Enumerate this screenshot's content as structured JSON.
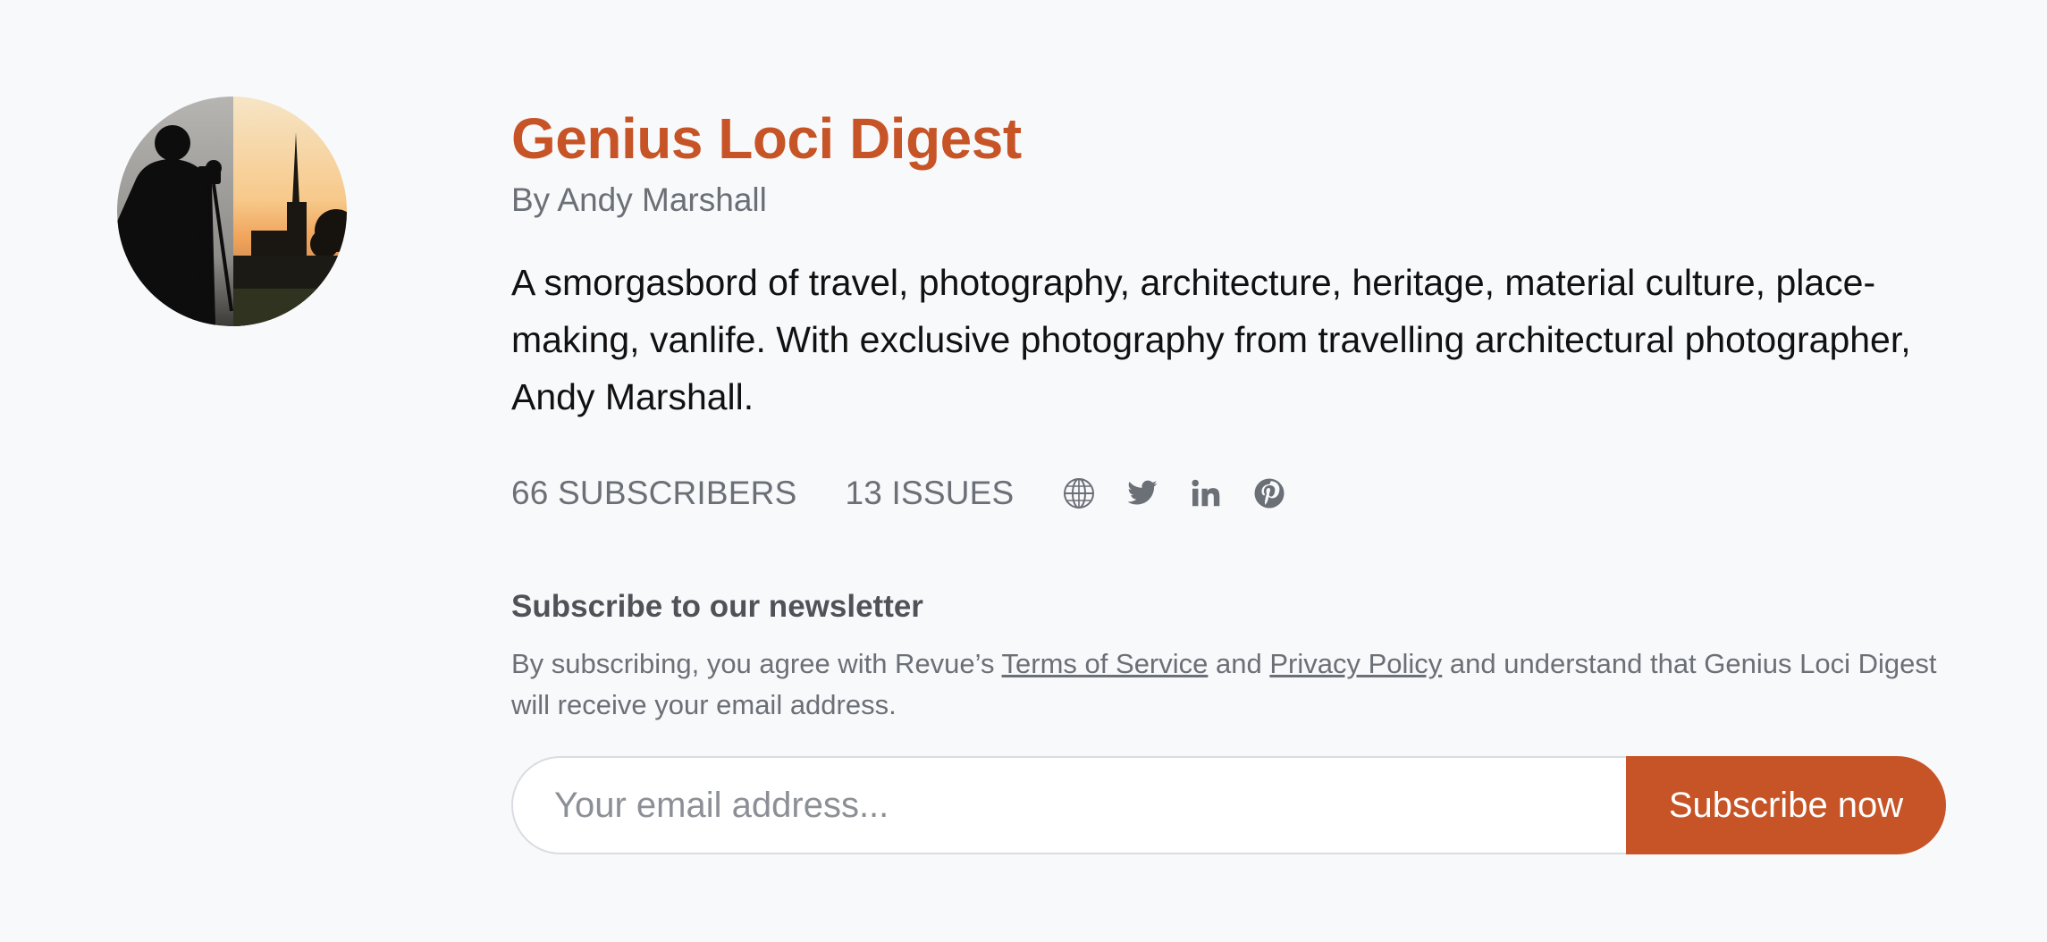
{
  "newsletter": {
    "title": "Genius Loci Digest",
    "byline": "By Andy Marshall",
    "description": "A smorgasbord of travel, photography, architecture, heritage, material culture, place-making, vanlife. With exclusive photography from travelling architectural photographer, Andy Marshall.",
    "subscribers": "66 SUBSCRIBERS",
    "issues": "13 ISSUES",
    "avatar_icon": "photographer-silhouette-avatar"
  },
  "socials": [
    {
      "name": "website",
      "icon": "globe-icon"
    },
    {
      "name": "twitter",
      "icon": "twitter-icon"
    },
    {
      "name": "linkedin",
      "icon": "linkedin-icon"
    },
    {
      "name": "pinterest",
      "icon": "pinterest-icon"
    }
  ],
  "subscribe": {
    "heading": "Subscribe to our newsletter",
    "legal_prefix": "By subscribing, you agree with Revue’s ",
    "terms_link": "Terms of Service",
    "legal_and": " and ",
    "privacy_link": "Privacy Policy",
    "legal_suffix": " and understand that Genius Loci Digest will receive your email address.",
    "email_placeholder": "Your email address...",
    "email_value": "",
    "button_label": "Subscribe now"
  },
  "colors": {
    "accent": "#c75426",
    "background": "#f8f9fb",
    "muted_text": "#6b6f76",
    "body_text": "#111111"
  }
}
